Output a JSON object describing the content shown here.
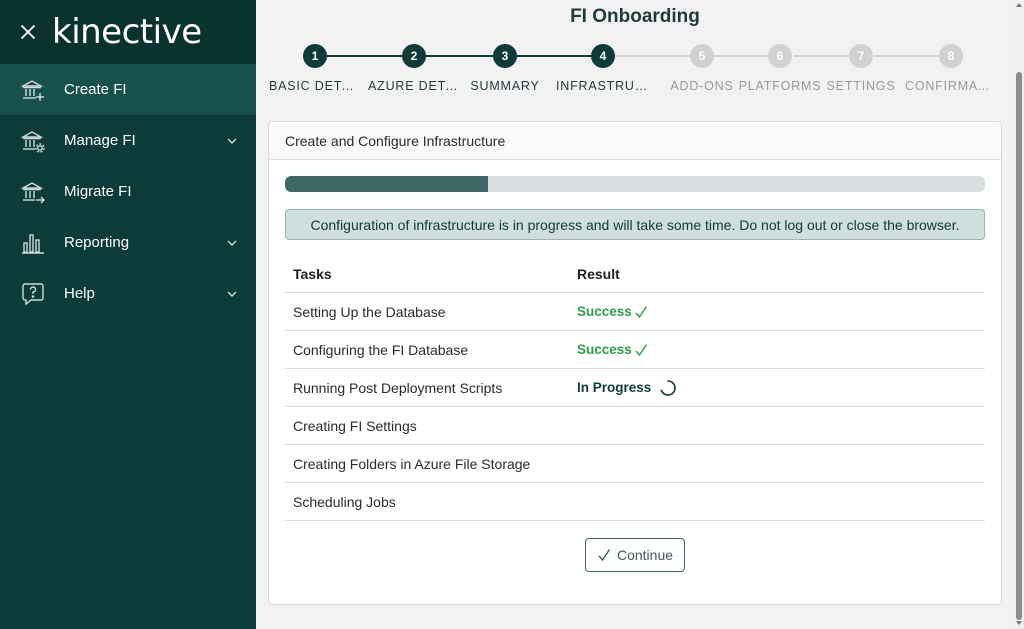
{
  "brand": {
    "logo_text": "kinective",
    "close_icon": "close-icon"
  },
  "sidebar": {
    "items": [
      {
        "label": "Create FI",
        "icon": "bank-plus-icon",
        "active": true,
        "expandable": false
      },
      {
        "label": "Manage FI",
        "icon": "bank-gear-icon",
        "active": false,
        "expandable": true
      },
      {
        "label": "Migrate FI",
        "icon": "bank-arrow-icon",
        "active": false,
        "expandable": false
      },
      {
        "label": "Reporting",
        "icon": "bar-chart-icon",
        "active": false,
        "expandable": true
      },
      {
        "label": "Help",
        "icon": "help-bubble-icon",
        "active": false,
        "expandable": true
      }
    ]
  },
  "page": {
    "title": "FI Onboarding"
  },
  "stepper": {
    "current": 4,
    "steps": [
      {
        "num": "1",
        "label": "BASIC DETAILS"
      },
      {
        "num": "2",
        "label": "AZURE DETAILS"
      },
      {
        "num": "3",
        "label": "SUMMARY"
      },
      {
        "num": "4",
        "label": "INFRASTRUCTURE"
      },
      {
        "num": "5",
        "label": "ADD-ONS"
      },
      {
        "num": "6",
        "label": "PLATFORMS"
      },
      {
        "num": "7",
        "label": "SETTINGS"
      },
      {
        "num": "8",
        "label": "CONFIRMATION"
      }
    ]
  },
  "card": {
    "title": "Create and Configure Infrastructure",
    "progress_fraction": 0.29,
    "alert_text": "Configuration of infrastructure is in progress and will take some time. Do not log out or close the browser.",
    "table": {
      "headers": {
        "tasks": "Tasks",
        "result": "Result"
      },
      "rows": [
        {
          "task": "Setting Up the Database",
          "result": "Success",
          "status": "success"
        },
        {
          "task": "Configuring the FI Database",
          "result": "Success",
          "status": "success"
        },
        {
          "task": "Running Post Deployment Scripts",
          "result": "In Progress",
          "status": "progress"
        },
        {
          "task": "Creating FI Settings",
          "result": "",
          "status": "pending"
        },
        {
          "task": "Creating Folders in Azure File Storage",
          "result": "",
          "status": "pending"
        },
        {
          "task": "Scheduling Jobs",
          "result": "",
          "status": "pending"
        }
      ]
    },
    "continue_label": "Continue"
  },
  "colors": {
    "sidebar_bg": "#0d3b39",
    "sidebar_active": "#17504d",
    "accent": "#0d3b39",
    "progress_fill": "#3e6766",
    "success": "#2e9e47",
    "step_inactive": "#d1d1d1"
  }
}
